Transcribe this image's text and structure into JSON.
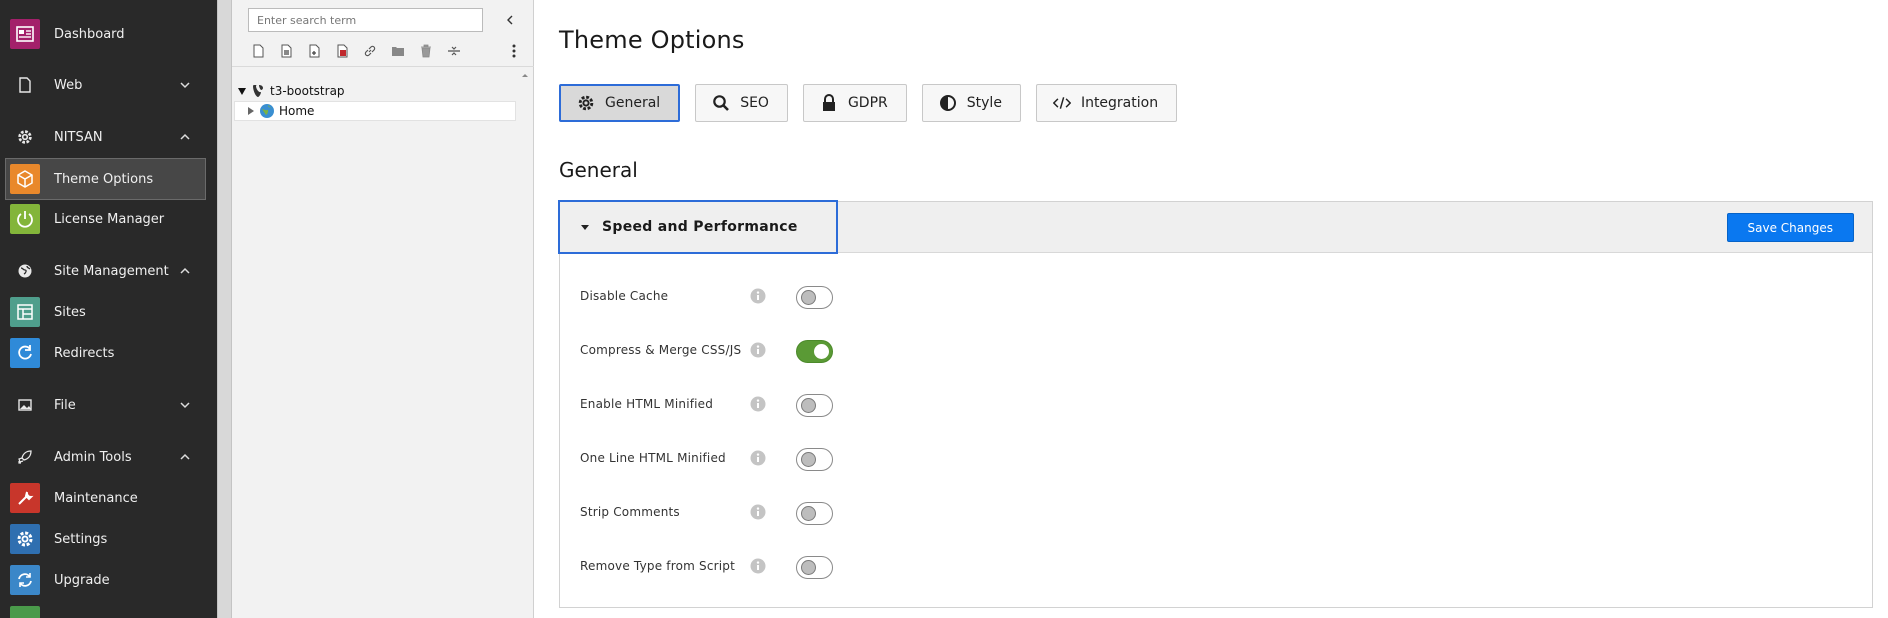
{
  "modmenu": {
    "dashboard": "Dashboard",
    "web": "Web",
    "nitsan": "NITSAN",
    "theme_options": "Theme Options",
    "license_manager": "License Manager",
    "site_management": "Site Management",
    "sites": "Sites",
    "redirects": "Redirects",
    "file": "File",
    "admin_tools": "Admin Tools",
    "maintenance": "Maintenance",
    "settings": "Settings",
    "upgrade": "Upgrade",
    "colors": {
      "dashboard": "#a3206a",
      "theme_options": "#e9882b",
      "license_manager": "#83b53a",
      "sites": "#4f9e8c",
      "redirects": "#2f8ad8",
      "maintenance": "#c8362b",
      "settings": "#2f6fb0",
      "upgrade": "#3b87c8"
    }
  },
  "tree": {
    "search_placeholder": "Enter search term",
    "root": "t3-bootstrap",
    "home": "Home",
    "toolbar_icons": [
      "new-page-icon",
      "new-page-inside-icon",
      "new-page-after-icon",
      "new-page-delete-icon",
      "link-icon",
      "folder-icon",
      "recycler-icon",
      "divider-icon"
    ]
  },
  "main": {
    "title": "Theme Options",
    "tabs": [
      "General",
      "SEO",
      "GDPR",
      "Style",
      "Integration"
    ],
    "active_tab": "General",
    "section_title": "General",
    "panel_title": "Speed and Performance",
    "save_label": "Save Changes",
    "options": [
      {
        "label": "Disable Cache",
        "enabled": false
      },
      {
        "label": "Compress & Merge CSS/JS",
        "enabled": true
      },
      {
        "label": "Enable HTML Minified",
        "enabled": false
      },
      {
        "label": "One Line HTML Minified",
        "enabled": false
      },
      {
        "label": "Strip Comments",
        "enabled": false
      },
      {
        "label": "Remove Type from Script",
        "enabled": false
      }
    ],
    "accent_color": "#2d6cd8",
    "button_color": "#0a78f0",
    "switch_on_color": "#5a9a35"
  }
}
